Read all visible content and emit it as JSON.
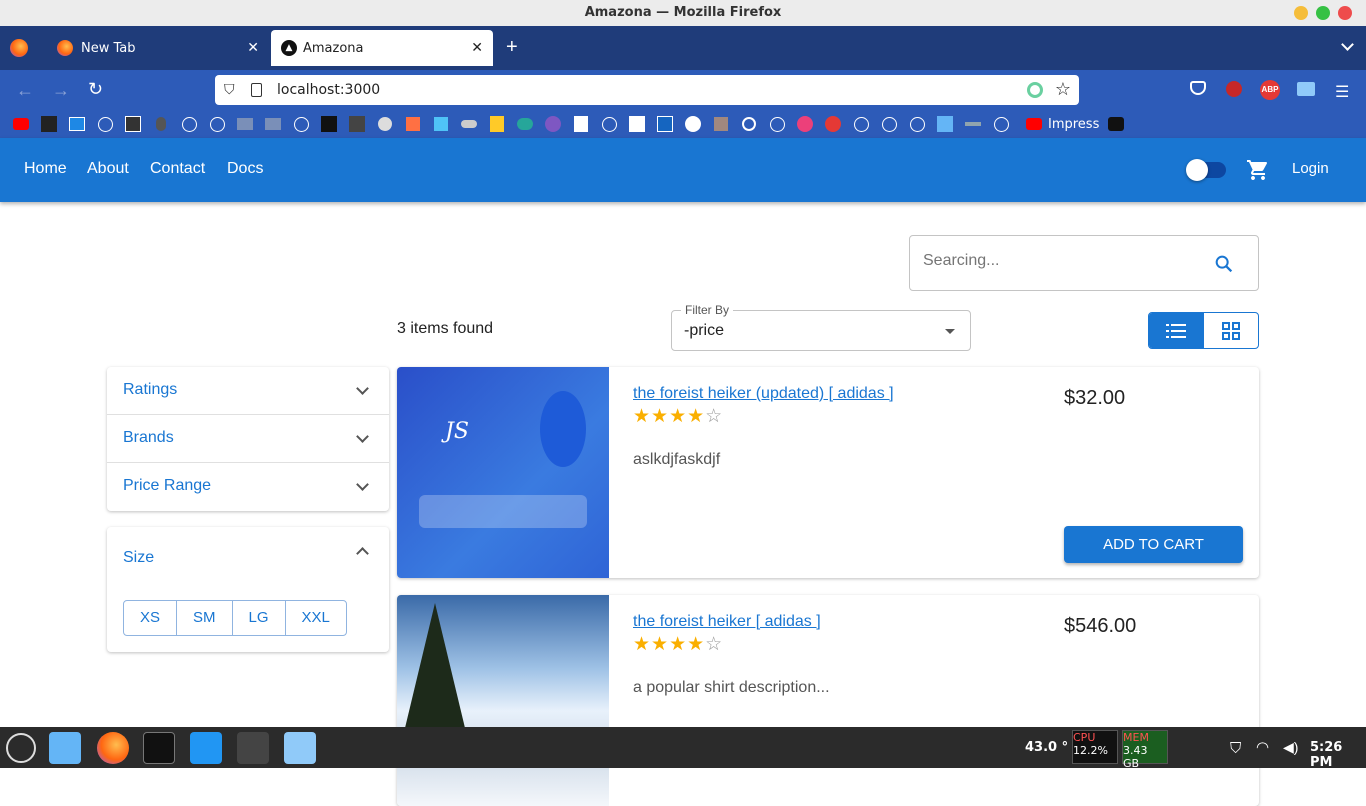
{
  "window": {
    "title": "Amazona — Mozilla Firefox"
  },
  "browser": {
    "tabs": [
      {
        "label": "New Tab"
      },
      {
        "label": "Amazona"
      }
    ],
    "url": "localhost:3000",
    "bookmarks": {
      "impress_label": "Impress"
    }
  },
  "appbar": {
    "links": [
      "Home",
      "About",
      "Contact",
      "Docs"
    ],
    "login": "Login"
  },
  "search": {
    "placeholder": "Searcing..."
  },
  "results": {
    "count_text": "3 items found"
  },
  "filter": {
    "label": "Filter By",
    "value": "-price"
  },
  "sidebar": {
    "sections": [
      "Ratings",
      "Brands",
      "Price Range"
    ],
    "size_title": "Size",
    "sizes": [
      "XS",
      "SM",
      "LG",
      "XXL"
    ]
  },
  "products": [
    {
      "title": "the foreist heiker (updated) [ adidas ]",
      "rating": 4,
      "description": "aslkdjfaskdjf",
      "price": "$32.00",
      "button": "ADD TO CART"
    },
    {
      "title": "the foreist heiker [ adidas ]",
      "rating": 4,
      "description": "a popular shirt description...",
      "price": "$546.00"
    }
  ],
  "taskbar": {
    "temperature": "43.0 °",
    "cpu_label": "CPU",
    "cpu_value": "12.2%",
    "mem_label": "MEM",
    "mem_value": "3.43 GB",
    "clock": "5:26 PM"
  },
  "colors": {
    "primary": "#1976d2",
    "star": "#faaf00"
  }
}
